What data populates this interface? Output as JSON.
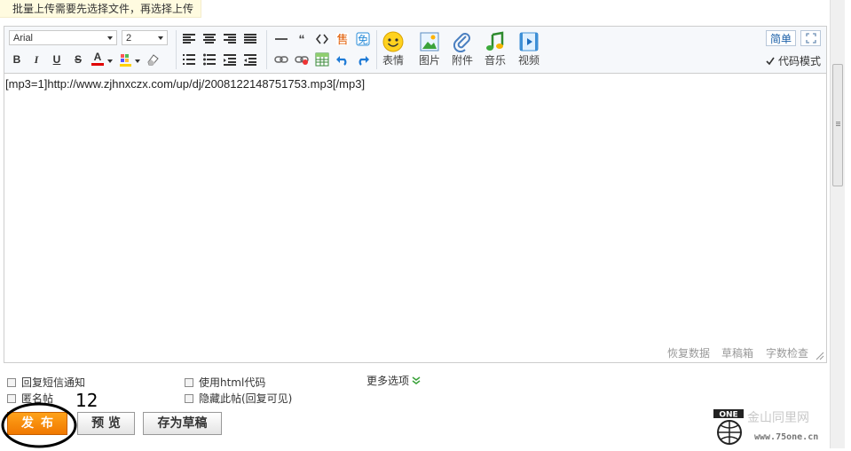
{
  "notice": "批量上传需要先选择文件，再选择上传",
  "toolbar": {
    "font_family": "Arial",
    "font_size": "2",
    "bold": "B",
    "italic": "I",
    "underline": "U",
    "strike": "S",
    "font_color": "A",
    "buttons": [
      {
        "label": "表情",
        "icon": "smiley-icon"
      },
      {
        "label": "图片",
        "icon": "image-icon"
      },
      {
        "label": "附件",
        "icon": "paperclip-icon"
      },
      {
        "label": "音乐",
        "icon": "music-icon"
      },
      {
        "label": "视频",
        "icon": "video-icon"
      }
    ],
    "simple_mode": "简单",
    "code_mode_label": "代码模式",
    "code_mode_checked": true
  },
  "editor": {
    "content": "[mp3=1]http://www.zjhnxczx.com/up/dj/2008122148751753.mp3[/mp3]",
    "status_links": [
      "恢复数据",
      "草稿箱",
      "字数检查"
    ]
  },
  "options": {
    "reply_notify": "回复短信通知",
    "anonymous": "匿名帖",
    "use_html": "使用html代码",
    "hide_post": "隐藏此帖(回复可见)",
    "more_options": "更多选项"
  },
  "actions": {
    "publish": "发布",
    "preview": "预 览",
    "save_draft": "存为草稿"
  },
  "annotation": {
    "number": "12"
  },
  "watermark": {
    "brand": "ONE",
    "cn_text": "金山同里网",
    "url": "www.75one.cn"
  },
  "colors": {
    "accent_orange": "#f07800",
    "link_blue": "#1a5fa8",
    "toolbar_bg": "#f6f8fb"
  }
}
